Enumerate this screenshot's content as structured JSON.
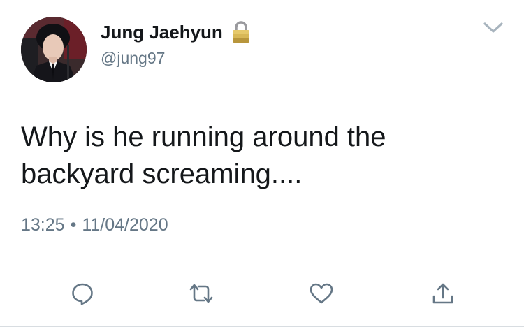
{
  "user": {
    "display_name": "Jung Jaehyun",
    "handle": "@jung97",
    "protected": true,
    "avatar_icon": "profile-photo"
  },
  "tweet": {
    "text": "Why is he running around the backyard screaming....",
    "time": "13:25",
    "separator": "•",
    "date": "11/04/2020"
  },
  "actions": [
    {
      "name": "reply",
      "icon": "reply-bubble-icon"
    },
    {
      "name": "retweet",
      "icon": "retweet-icon"
    },
    {
      "name": "like",
      "icon": "heart-icon"
    },
    {
      "name": "share",
      "icon": "share-icon"
    }
  ],
  "colors": {
    "text": "#14171a",
    "secondary": "#657786",
    "icon": "#657786",
    "divider": "#d8dde1",
    "lock_gold": "#c9a74a"
  }
}
